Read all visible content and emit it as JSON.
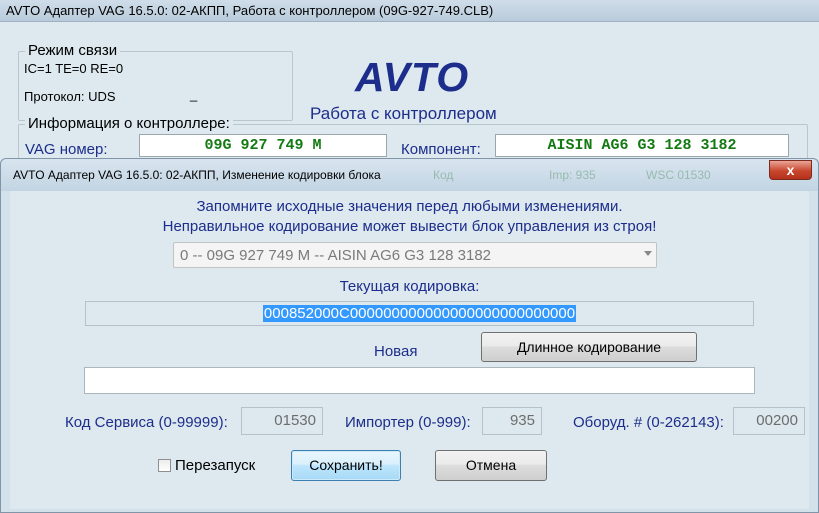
{
  "back_window": {
    "title": "AVTO Адаптер VAG 16.5.0: 02-АКПП,  Работа с контроллером (09G-927-749.CLB)",
    "comm_group": {
      "legend": "Режим связи",
      "line1": "IC=1  TE=0  RE=0",
      "protocol_label": "Протокол: UDS",
      "protocol_extra": "_"
    },
    "logo": "AVTO",
    "subtitle": "Работа с контроллером",
    "info_group": {
      "legend": "Информация о контроллере:",
      "vag_label": "VAG номер:",
      "vag_value": "09G 927 749 M",
      "component_label": "Компонент:",
      "component_value": "AISIN AG6 G3  128 3182"
    }
  },
  "dialog": {
    "title": "AVTO Адаптер VAG 16.5.0: 02-АКПП,  Изменение кодировки блока",
    "close_label": "x",
    "ghost_left": "Код",
    "ghost_mid": "Imp: 935",
    "ghost_right": "WSC 01530",
    "warning_line1": "Запомните исходные значения перед любыми изменениями.",
    "warning_line2": "Неправильное кодирование может вывести блок управления из строя!",
    "module_select": "0 -- 09G 927 749 M -- AISIN AG6 G3  128 3182",
    "current_coding_label": "Текущая кодировка:",
    "current_coding_value": "000852000C000000000000000000000000000",
    "new_label": "Новая",
    "long_coding_button": "Длинное кодирование",
    "new_coding_value": "",
    "service_code_label": "Код Сервиса (0-99999):",
    "service_code_value": "01530",
    "importer_label": "Импортер (0-999):",
    "importer_value": "935",
    "equipment_label": "Оборуд. # (0-262143):",
    "equipment_value": "00200",
    "restart_label": "Перезапуск",
    "save_button": "Сохранить!",
    "cancel_button": "Отмена"
  }
}
